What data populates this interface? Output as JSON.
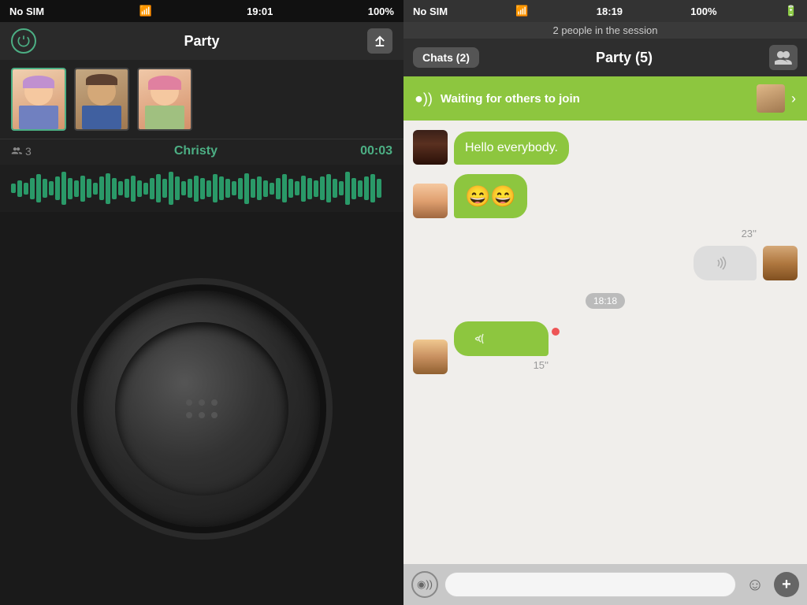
{
  "left": {
    "statusBar": {
      "carrier": "No SIM",
      "time": "19:01",
      "battery": "100%"
    },
    "header": {
      "title": "Party",
      "powerLabel": "⏻",
      "uploadLabel": "⬆"
    },
    "avatars": [
      {
        "id": "a1",
        "active": true
      },
      {
        "id": "a2",
        "active": false
      },
      {
        "id": "a3",
        "active": false
      }
    ],
    "info": {
      "peopleCount": "3",
      "activeName": "Christy",
      "timer": "00:03"
    },
    "waveform": {
      "bars": [
        4,
        7,
        5,
        9,
        12,
        8,
        6,
        10,
        14,
        9,
        7,
        11,
        8,
        5,
        10,
        13,
        9,
        6,
        8,
        11,
        7,
        5,
        9,
        12,
        8,
        14,
        10,
        6,
        8,
        11,
        9,
        7,
        12,
        10,
        8,
        6,
        9,
        13,
        8,
        10,
        7,
        5,
        9,
        12,
        8,
        6,
        11,
        9,
        7,
        10,
        12,
        8,
        6,
        14,
        9,
        7,
        10,
        12,
        8
      ]
    }
  },
  "right": {
    "statusBar": {
      "carrier": "No SIM",
      "time": "18:19",
      "battery": "100%"
    },
    "sessionBar": {
      "text": "2 people in the session"
    },
    "header": {
      "chatsLabel": "Chats (2)",
      "partyLabel": "Party  (5)",
      "peopleIcon": "👥"
    },
    "waitingBar": {
      "signalIcon": "◉))",
      "text": "Waiting for others to join"
    },
    "messages": [
      {
        "id": "m1",
        "type": "incoming",
        "avatarClass": "avatar-dark-woman",
        "bubbleType": "green",
        "text": "Hello everybody."
      },
      {
        "id": "m2",
        "type": "incoming",
        "avatarClass": "avatar-woman-blonde",
        "bubbleType": "green",
        "text": "😄😄"
      },
      {
        "id": "m3",
        "type": "outgoing",
        "avatarClass": "avatar-man-brown",
        "bubbleType": "gray",
        "text": "((◉",
        "duration": "23''"
      },
      {
        "id": "m4",
        "type": "timestamp",
        "text": "18:18"
      },
      {
        "id": "m5",
        "type": "incoming",
        "avatarClass": "avatar-woman-blonde",
        "bubbleType": "green-right",
        "text": "◉))",
        "duration": "15''",
        "recording": true
      }
    ],
    "inputBar": {
      "micLabel": "◉))",
      "placeholder": "",
      "emojiLabel": "☺",
      "addLabel": "+"
    }
  }
}
